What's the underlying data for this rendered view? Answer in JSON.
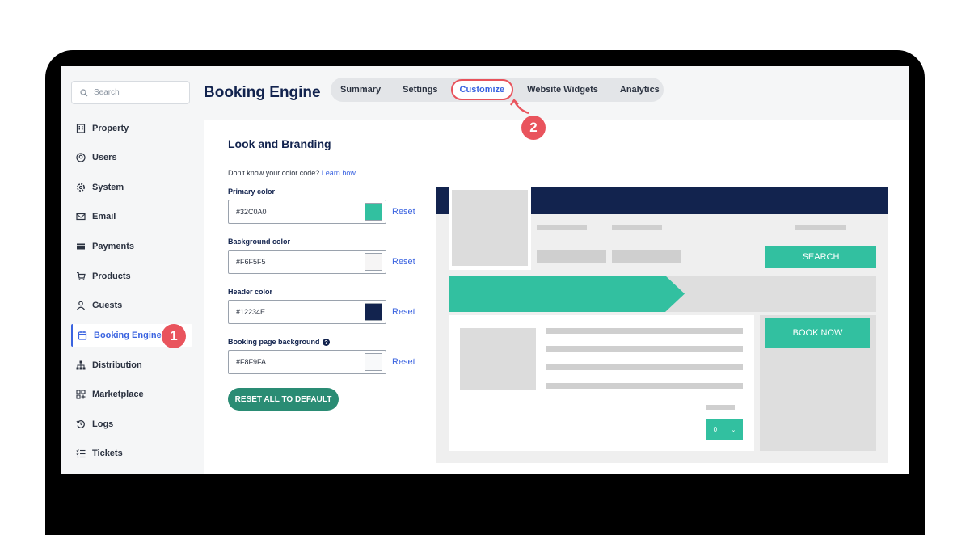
{
  "sidebar": {
    "search_placeholder": "Search",
    "items": [
      {
        "label": "Property",
        "icon": "building-icon"
      },
      {
        "label": "Users",
        "icon": "user-circle-icon"
      },
      {
        "label": "System",
        "icon": "gear-icon"
      },
      {
        "label": "Email",
        "icon": "envelope-icon"
      },
      {
        "label": "Payments",
        "icon": "card-icon"
      },
      {
        "label": "Products",
        "icon": "cart-icon"
      },
      {
        "label": "Guests",
        "icon": "person-icon"
      },
      {
        "label": "Booking Engine",
        "icon": "calendar-icon",
        "active": true
      },
      {
        "label": "Distribution",
        "icon": "hierarchy-icon"
      },
      {
        "label": "Marketplace",
        "icon": "grid-icon"
      },
      {
        "label": "Logs",
        "icon": "history-icon"
      },
      {
        "label": "Tickets",
        "icon": "checklist-icon"
      }
    ]
  },
  "header": {
    "title": "Booking Engine",
    "tabs": [
      {
        "label": "Summary"
      },
      {
        "label": "Settings"
      },
      {
        "label": "Customize",
        "active": true
      },
      {
        "label": "Website Widgets"
      },
      {
        "label": "Analytics"
      }
    ]
  },
  "annotations": {
    "step1": "1",
    "step2": "2"
  },
  "branding": {
    "section_title": "Look and Branding",
    "hint_text": "Don't know your color code?",
    "hint_link": "Learn how.",
    "fields": [
      {
        "label": "Primary color",
        "value": "#32C0A0",
        "swatch": "#32C0A0",
        "reset": "Reset"
      },
      {
        "label": "Background color",
        "value": "#F6F5F5",
        "swatch": "#F6F5F5",
        "reset": "Reset"
      },
      {
        "label": "Header color",
        "value": "#12234E",
        "swatch": "#12234E",
        "reset": "Reset"
      },
      {
        "label": "Booking page background",
        "value": "#F8F9FA",
        "swatch": "#F8F9FA",
        "reset": "Reset"
      }
    ],
    "reset_all_label": "RESET ALL TO DEFAULT"
  },
  "preview": {
    "search_button": "SEARCH",
    "book_now_button": "BOOK NOW",
    "quantity_value": "0",
    "header_color": "#12234E",
    "accent_color": "#32C0A0"
  },
  "colors": {
    "accent_blue": "#3A63E0",
    "annotation_red": "#E9545D",
    "reset_all_green": "#2A8C74"
  }
}
